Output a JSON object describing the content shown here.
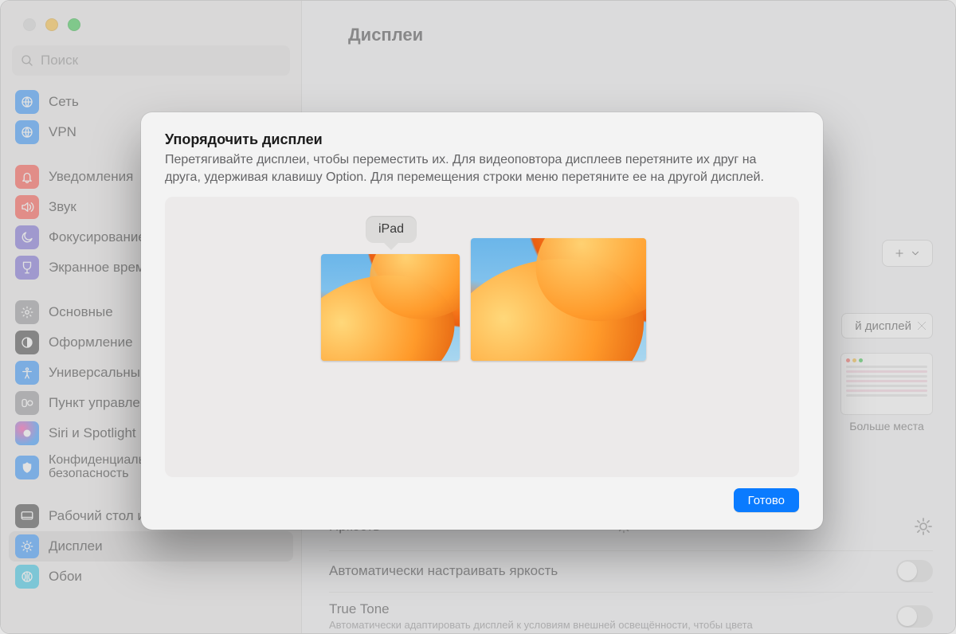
{
  "header": {
    "title": "Дисплеи"
  },
  "search": {
    "placeholder": "Поиск"
  },
  "sidebar": {
    "items": [
      {
        "label": "Сеть",
        "iconClass": "ic-network"
      },
      {
        "label": "VPN",
        "iconClass": "ic-vpn"
      },
      {
        "label": "Уведомления",
        "iconClass": "ic-notif",
        "gapBefore": true
      },
      {
        "label": "Звук",
        "iconClass": "ic-sound"
      },
      {
        "label": "Фокусирование",
        "iconClass": "ic-focus"
      },
      {
        "label": "Экранное время",
        "iconClass": "ic-screen"
      },
      {
        "label": "Основные",
        "iconClass": "ic-general",
        "gapBefore": true
      },
      {
        "label": "Оформление",
        "iconClass": "ic-appear"
      },
      {
        "label": "Универсальный доступ",
        "iconClass": "ic-universal"
      },
      {
        "label": "Пункт управления",
        "iconClass": "ic-control"
      },
      {
        "label": "Siri и Spotlight",
        "iconClass": "ic-siri"
      },
      {
        "label": "Конфиденциальность и",
        "iconClass": "ic-privacy",
        "label2": "безопасность"
      },
      {
        "label": "Рабочий стол и Dock",
        "iconClass": "ic-dock",
        "gapBefore": true
      },
      {
        "label": "Дисплеи",
        "iconClass": "ic-displays",
        "selected": true
      },
      {
        "label": "Обои",
        "iconClass": "ic-wallpaper"
      }
    ]
  },
  "main": {
    "popupLabel": "й дисплей",
    "thumbLabel": "Больше места",
    "brightnessLabel": "Яркость",
    "autoBrightLabel": "Автоматически настраивать яркость",
    "trueToneLabel": "True Tone",
    "trueToneSub": "Автоматически адаптировать дисплей к условиям внешней освещённости, чтобы цвета"
  },
  "dialog": {
    "title": "Упорядочить дисплеи",
    "desc": "Перетягивайте дисплеи, чтобы переместить их. Для видеоповтора дисплеев перетяните их друг на друга, удерживая клавишу Option. Для перемещения строки меню перетяните ее на другой дисплей.",
    "tooltip": "iPad",
    "doneLabel": "Готово"
  }
}
